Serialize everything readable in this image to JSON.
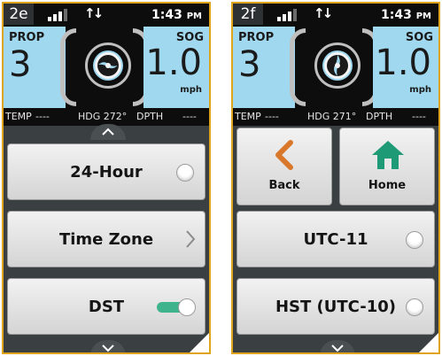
{
  "panels": {
    "left": {
      "figure_label": "2e",
      "status": {
        "time": "1:43",
        "ampm": "PM",
        "signal_bars_active": 3
      },
      "gauges": {
        "prop_label": "PROP",
        "prop_value": "3",
        "sog_label": "SOG",
        "sog_value": "1.0",
        "sog_unit": "mph"
      },
      "center_icon": "propeller-top-icon",
      "info": {
        "temp_label": "TEMP",
        "temp_value": "----",
        "hdg": "HDG 272°",
        "dpth_label": "DPTH",
        "dpth_value": "----"
      },
      "menu": [
        {
          "label": "24-Hour",
          "control": "radio",
          "state": "off"
        },
        {
          "label": "Time Zone",
          "control": "chevron"
        },
        {
          "label": "DST",
          "control": "toggle",
          "state": "on"
        }
      ]
    },
    "right": {
      "figure_label": "2f",
      "status": {
        "time": "1:43",
        "ampm": "PM",
        "signal_bars_active": 3
      },
      "gauges": {
        "prop_label": "PROP",
        "prop_value": "3",
        "sog_label": "SOG",
        "sog_value": "1.0",
        "sog_unit": "mph"
      },
      "center_icon": "propeller-side-icon",
      "info": {
        "temp_label": "TEMP",
        "temp_value": "----",
        "hdg": "HDG 271°",
        "dpth_label": "DPTH",
        "dpth_value": "----"
      },
      "nav": {
        "back_label": "Back",
        "home_label": "Home"
      },
      "menu": [
        {
          "label": "UTC-11",
          "control": "radio",
          "state": "off"
        },
        {
          "label": "HST (UTC-10)",
          "control": "radio",
          "state": "off"
        }
      ]
    }
  },
  "colors": {
    "frame": "#e0a41c",
    "gauge_bg": "#9fd8ef",
    "toggle_on": "#3fb38c",
    "back_arrow": "#d9782a",
    "home_icon": "#1e9b76"
  }
}
